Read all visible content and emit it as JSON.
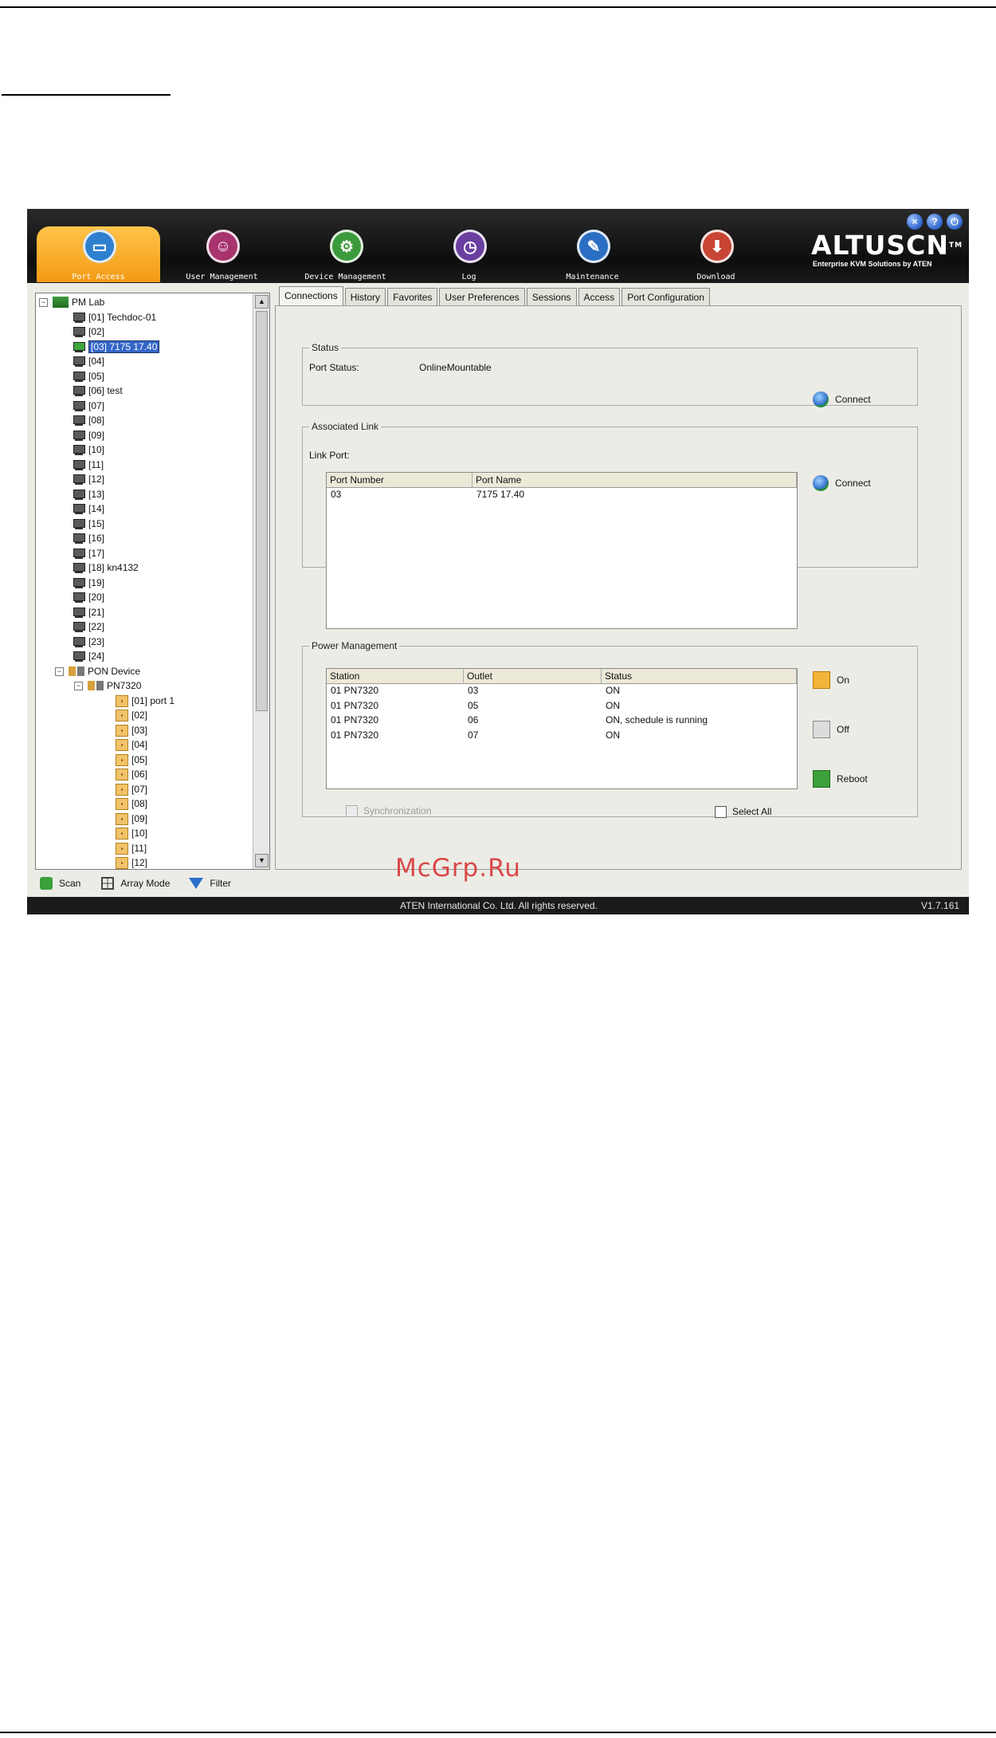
{
  "header": {
    "nav_items": [
      {
        "label": "Port Access",
        "icon": "monitor-icon",
        "color": "#2f7fd0"
      },
      {
        "label": "User Management",
        "icon": "users-icon",
        "color": "#a8336d"
      },
      {
        "label": "Device Management",
        "icon": "device-icon",
        "color": "#3b9a3b"
      },
      {
        "label": "Log",
        "icon": "log-icon",
        "color": "#6a3fa0"
      },
      {
        "label": "Maintenance",
        "icon": "maintenance-icon",
        "color": "#2b6fc4"
      },
      {
        "label": "Download",
        "icon": "download-icon",
        "color": "#c84433"
      }
    ],
    "brand_name": "ALTUSCN",
    "brand_tm": "TM",
    "brand_sub": "Enterprise KVM Solutions by ATEN",
    "window_controls": [
      "close-icon",
      "help-icon",
      "logout-icon"
    ],
    "active_color": "#f6a821"
  },
  "tree": {
    "root": "PM Lab",
    "ports": [
      "[01] Techdoc-01",
      "[02]",
      "[03] 7175 17.40",
      "[04]",
      "[05]",
      "[06] test",
      "[07]",
      "[08]",
      "[09]",
      "[10]",
      "[11]",
      "[12]",
      "[13]",
      "[14]",
      "[15]",
      "[16]",
      "[17]",
      "[18] kn4132",
      "[19]",
      "[20]",
      "[21]",
      "[22]",
      "[23]",
      "[24]"
    ],
    "pdu_group": "PON Device",
    "pdu": "PN7320",
    "outlets": [
      "[01] port 1",
      "[02]",
      "[03]",
      "[04]",
      "[05]",
      "[06]",
      "[07]",
      "[08]",
      "[09]",
      "[10]",
      "[11]",
      "[12]"
    ]
  },
  "left_toolbar": {
    "scan": "Scan",
    "array_mode": "Array Mode",
    "filter": "Filter"
  },
  "tabs": [
    "Connections",
    "History",
    "Favorites",
    "User Preferences",
    "Sessions",
    "Access",
    "Port Configuration"
  ],
  "status_group": {
    "title": "Status",
    "port_status_label": "Port Status:",
    "port_status_value": "OnlineMountable",
    "connect": "Connect"
  },
  "associated_link": {
    "title": "Associated Link",
    "link_port_label": "Link Port:",
    "headers": [
      "Port Number",
      "Port Name"
    ],
    "rows": [
      [
        "03",
        "7175 17.40"
      ]
    ],
    "connect": "Connect"
  },
  "power_management": {
    "title": "Power Management",
    "headers": [
      "Station",
      "Outlet",
      "Status"
    ],
    "rows": [
      [
        "01 PN7320",
        "03",
        "ON"
      ],
      [
        "01 PN7320",
        "05",
        "ON"
      ],
      [
        "01 PN7320",
        "06",
        "ON, schedule is running"
      ],
      [
        "01 PN7320",
        "07",
        "ON"
      ]
    ],
    "on": "On",
    "off": "Off",
    "reboot": "Reboot",
    "synchronization": "Synchronization",
    "select_all": "Select All"
  },
  "watermark": "McGrp.Ru",
  "footer": {
    "copyright": "ATEN International Co. Ltd. All rights reserved.",
    "version": "V1.7.161"
  }
}
